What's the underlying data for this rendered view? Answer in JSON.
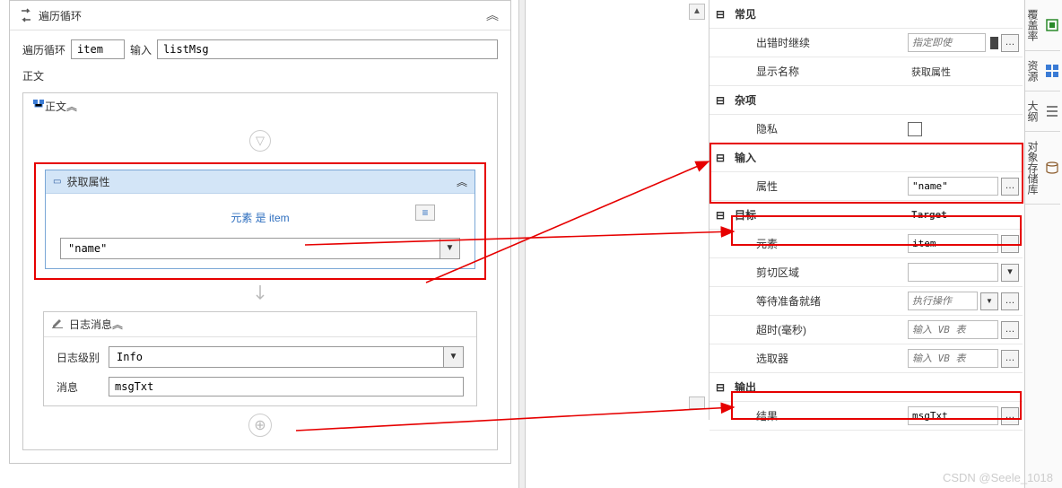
{
  "foreach": {
    "title": "遍历循环",
    "item_label": "遍历循环",
    "item_value": "item",
    "input_label": "输入",
    "input_value": "listMsg",
    "body_label": "正文"
  },
  "sequence": {
    "title": "正文"
  },
  "getattr": {
    "title": "获取属性",
    "element_line": "元素 是 item",
    "attr_value": "\"name\""
  },
  "logmsg": {
    "title": "日志消息",
    "level_label": "日志级别",
    "level_value": "Info",
    "msg_label": "消息",
    "msg_value": "msgTxt"
  },
  "props": {
    "cats": {
      "common": "常见",
      "misc": "杂项",
      "input": "输入",
      "target": "目标",
      "target_val": "Target",
      "output": "输出"
    },
    "rows": {
      "continue_on_error": {
        "k": "出错时继续",
        "ph": "指定即使"
      },
      "display_name": {
        "k": "显示名称",
        "v": "获取属性"
      },
      "private": {
        "k": "隐私"
      },
      "attribute": {
        "k": "属性",
        "v": "\"name\""
      },
      "element": {
        "k": "元素",
        "v": "item"
      },
      "clip_region": {
        "k": "剪切区域"
      },
      "wait_ready": {
        "k": "等待准备就绪",
        "ph": "执行操作"
      },
      "timeout": {
        "k": "超时(毫秒)",
        "ph": "输入 VB 表"
      },
      "selector": {
        "k": "选取器",
        "ph": "输入 VB 表"
      },
      "result": {
        "k": "结果",
        "v": "msgTxt"
      }
    }
  },
  "sidetabs": {
    "coverage": "覆盖率",
    "resources": "资源",
    "outline": "大纲",
    "repo": "对象存储库"
  },
  "watermark": "CSDN @Seele_1018"
}
